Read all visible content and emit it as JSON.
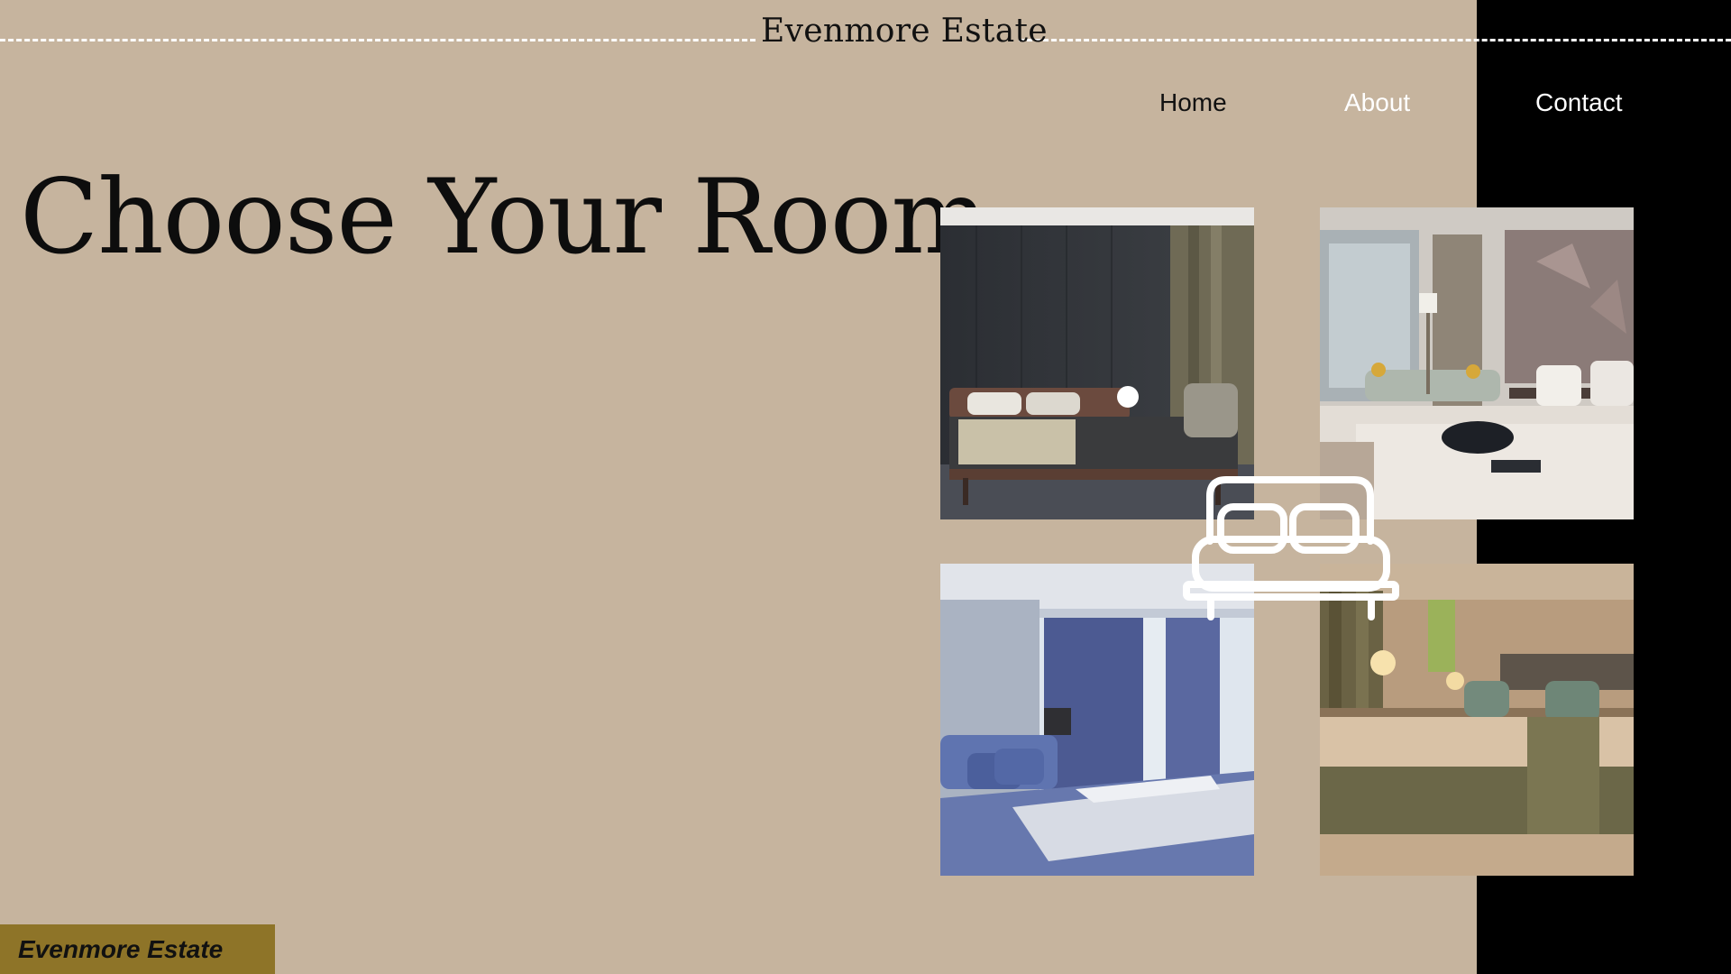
{
  "header": {
    "brand": "Evenmore Estate"
  },
  "nav": {
    "items": [
      {
        "label": "Home"
      },
      {
        "label": "About"
      },
      {
        "label": "Contact"
      }
    ]
  },
  "hero": {
    "title": "Choose Your Room"
  },
  "gallery": {
    "rooms": [
      {
        "description": "dark wood paneled bedroom"
      },
      {
        "description": "city view suite with sofa"
      },
      {
        "description": "blue curtained bedroom"
      },
      {
        "description": "warm olive toned bedroom"
      }
    ],
    "overlay_icon": "bed-icon"
  },
  "footer": {
    "brand": "Evenmore Estate"
  },
  "colors": {
    "background": "#c6b49e",
    "panel": "#000000",
    "accent": "#8e7428",
    "text_dark": "#111111",
    "text_light": "#ffffff"
  }
}
